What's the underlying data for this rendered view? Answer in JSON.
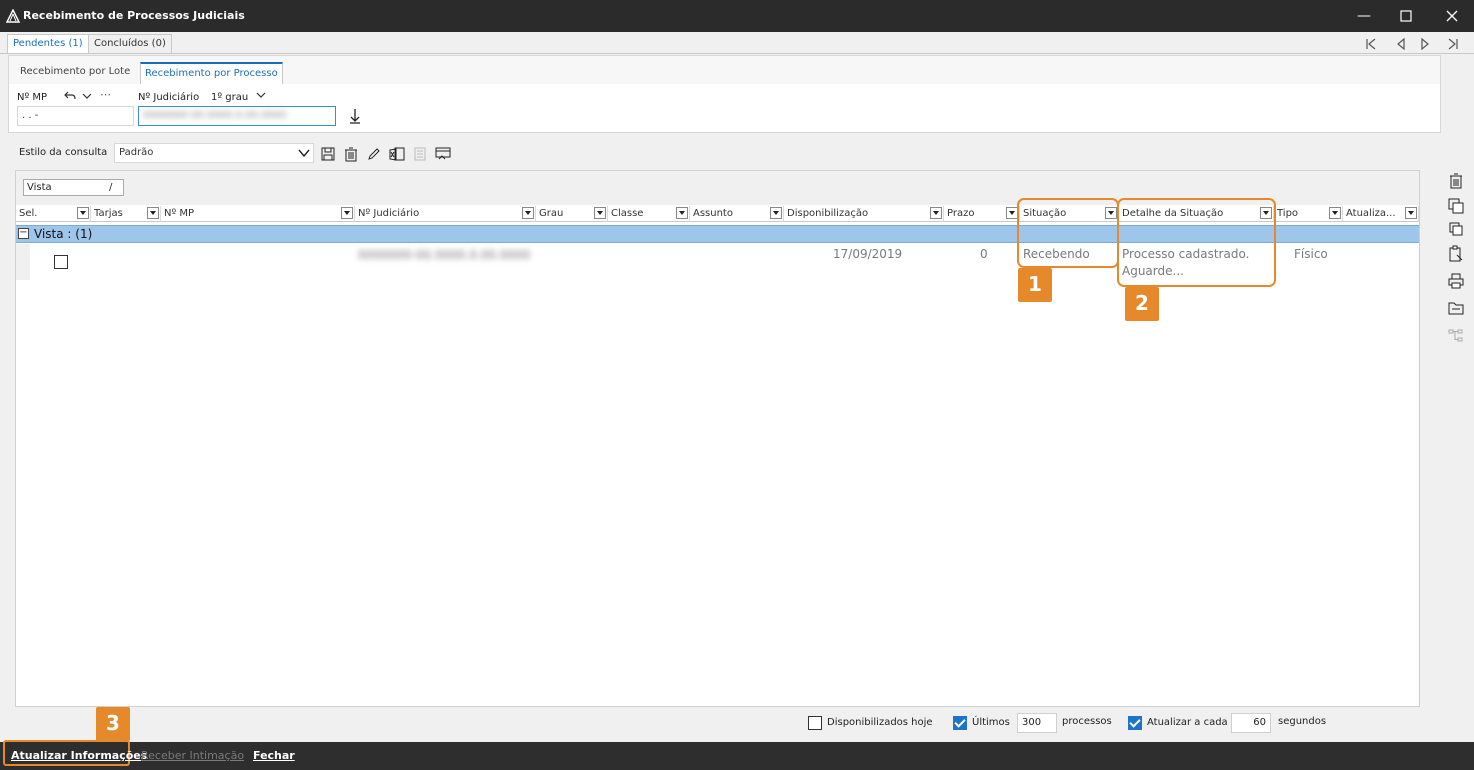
{
  "window": {
    "title": "Recebimento de Processos Judiciais"
  },
  "tabs": [
    {
      "label": "Pendentes (1)"
    },
    {
      "label": "Concluídos (0)"
    }
  ],
  "subtabs": [
    {
      "label": "Recebimento por Lote"
    },
    {
      "label": "Recebimento por Processo"
    }
  ],
  "form": {
    "mp_label": "Nº MP",
    "mp_value": ". .    -",
    "judiciario_label": "Nº Judiciário",
    "grau_label": "1º grau",
    "judiciario_value": "0000000-00.0000.0.00.0000"
  },
  "style_bar": {
    "label": "Estilo da consulta",
    "value": "Padrão"
  },
  "grid": {
    "vista_label": "Vista",
    "vista_slash": "/",
    "columns": [
      "Sel.",
      "Tarjas",
      "Nº MP",
      "Nº Judiciário",
      "Grau",
      "Classe",
      "Assunto",
      "Disponibilização",
      "Prazo",
      "Situação",
      "Detalhe da Situação",
      "Tipo",
      "Atualiza..."
    ],
    "group_label": "Vista :  (1)",
    "rows": [
      {
        "judiciario": "0000000-00.0000.0.00.0000",
        "disponibilizacao": "17/09/2019",
        "prazo": "0",
        "situacao": "Recebendo",
        "detalhe_line1": "Processo cadastrado.",
        "detalhe_line2": "Aguarde...",
        "tipo": "Físico"
      }
    ]
  },
  "callouts": [
    "1",
    "2",
    "3"
  ],
  "footer": {
    "disponibilizados_hoje": "Disponibilizados hoje",
    "ultimos": "Últimos",
    "ultimos_value": "300",
    "processos": "processos",
    "atualizar_cada": "Atualizar a cada",
    "segundos_value": "60",
    "segundos": "segundos"
  },
  "actions": {
    "atualizar": "Atualizar Informações",
    "receber": "Receber Intimação",
    "fechar": "Fechar"
  },
  "colors": {
    "accent": "#1a6fbd",
    "callout": "#e5892b",
    "group_row": "#9ec6ea",
    "checkbox_on": "#1e74c8"
  }
}
